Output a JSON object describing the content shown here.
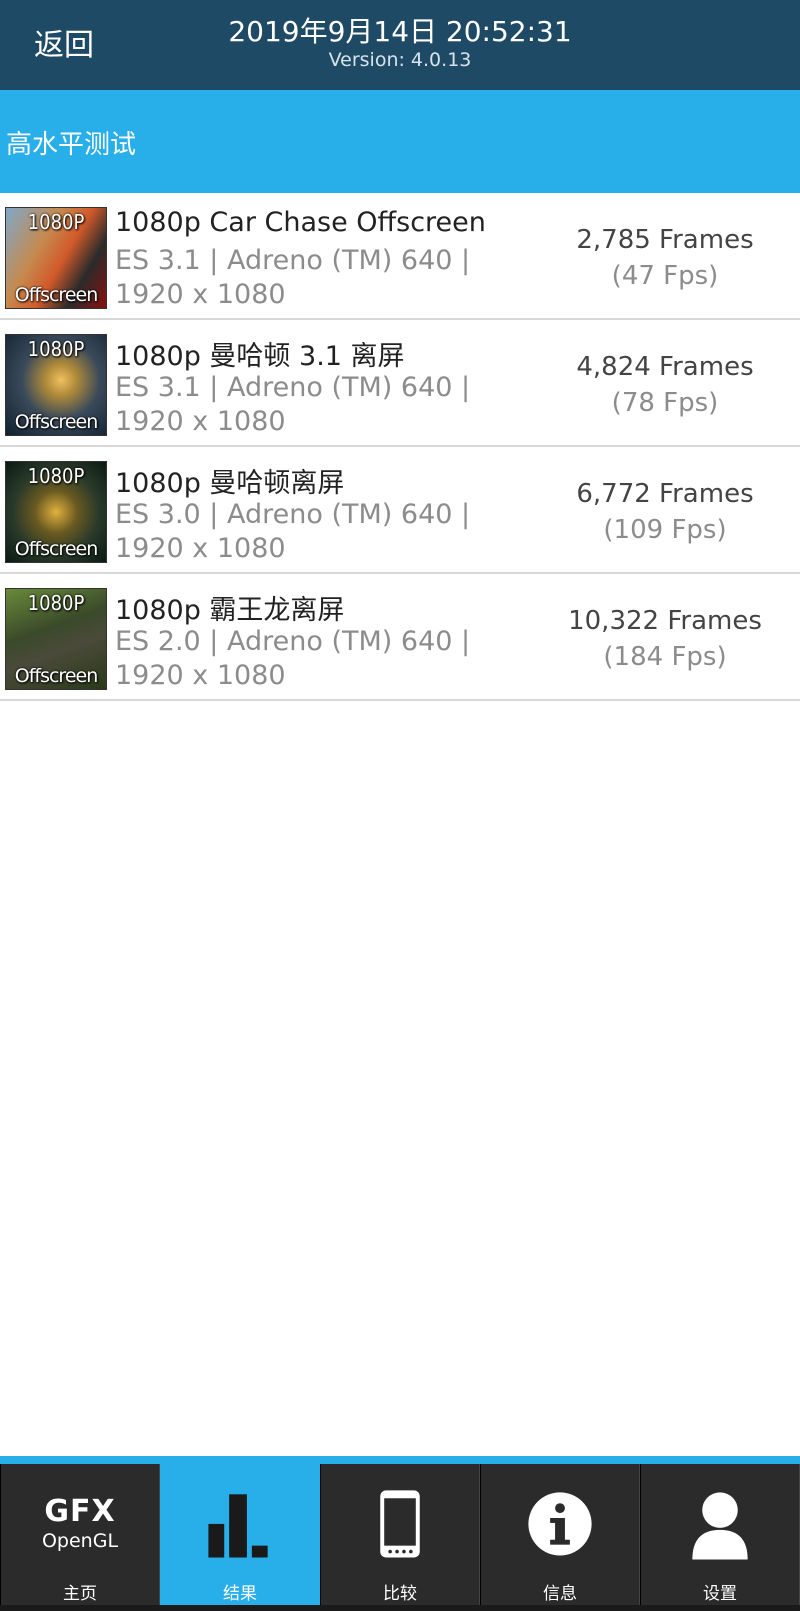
{
  "header": {
    "back_label": "返回",
    "title": "2019年9月14日 20:52:31",
    "version": "Version: 4.0.13"
  },
  "section": {
    "title": "高水平测试"
  },
  "results": [
    {
      "thumb_top": "1080P",
      "thumb_bottom": "Offscreen",
      "title": "1080p Car Chase Offscreen",
      "api_line": "ES 3.1 | Adreno (TM) 640 |",
      "resolution": "1920 x 1080",
      "frames": "2,785 Frames",
      "fps": "(47 Fps)"
    },
    {
      "thumb_top": "1080P",
      "thumb_bottom": "Offscreen",
      "title": "1080p 曼哈顿 3.1 离屏",
      "api_line": "ES 3.1 | Adreno (TM) 640 |",
      "resolution": "1920 x 1080",
      "frames": "4,824 Frames",
      "fps": "(78 Fps)"
    },
    {
      "thumb_top": "1080P",
      "thumb_bottom": "Offscreen",
      "title": "1080p 曼哈顿离屏",
      "api_line": "ES 3.0 | Adreno (TM) 640 |",
      "resolution": "1920 x 1080",
      "frames": "6,772 Frames",
      "fps": "(109 Fps)"
    },
    {
      "thumb_top": "1080P",
      "thumb_bottom": "Offscreen",
      "title": "1080p 霸王龙离屏",
      "api_line": "ES 2.0 | Adreno (TM) 640 |",
      "resolution": "1920 x 1080",
      "frames": "10,322 Frames",
      "fps": "(184 Fps)"
    }
  ],
  "tabbar": {
    "home_logo_top": "GFX",
    "home_logo_bottom": "OpenGL",
    "tabs": [
      {
        "label": "主页",
        "icon": "gfx-logo-icon",
        "active": false
      },
      {
        "label": "结果",
        "icon": "bar-chart-icon",
        "active": true
      },
      {
        "label": "比较",
        "icon": "phone-icon",
        "active": false
      },
      {
        "label": "信息",
        "icon": "info-icon",
        "active": false
      },
      {
        "label": "设置",
        "icon": "user-icon",
        "active": false
      }
    ]
  },
  "colors": {
    "header_bg": "#1f4a66",
    "accent": "#28aee9",
    "tab_bg": "#2b2b2b"
  }
}
